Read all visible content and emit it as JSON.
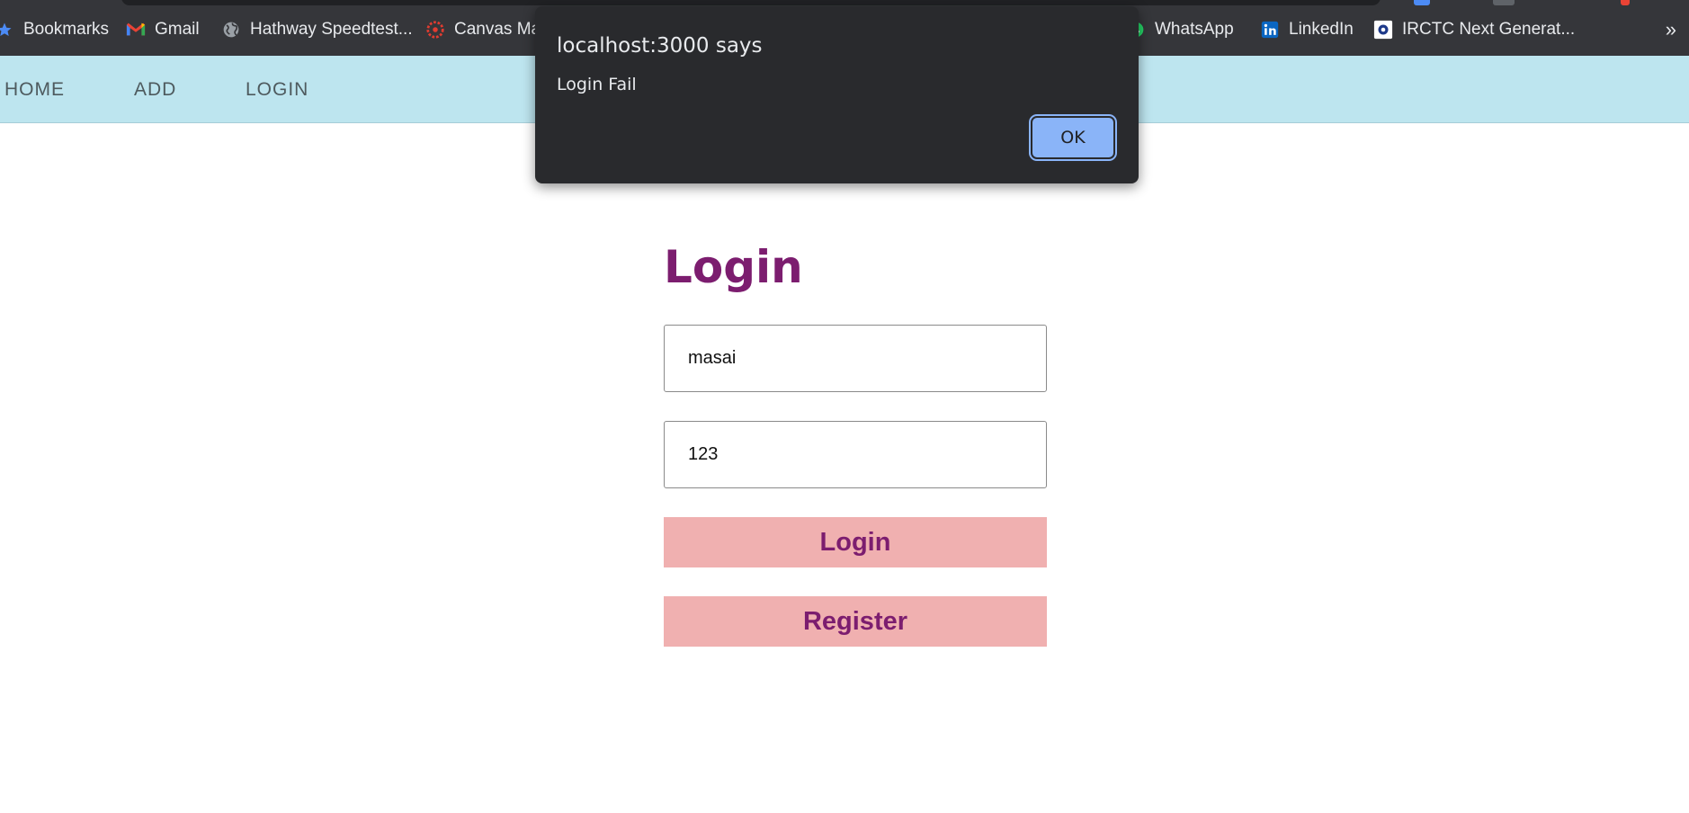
{
  "browser": {
    "bookmarks": [
      {
        "label": "Bookmarks",
        "icon": "star-icon"
      },
      {
        "label": "Gmail",
        "icon": "gmail-icon"
      },
      {
        "label": "Hathway Speedtest...",
        "icon": "globe-icon"
      },
      {
        "label": "Canvas Ma",
        "icon": "canvas-icon"
      },
      {
        "label": "WhatsApp",
        "icon": "whatsapp-icon"
      },
      {
        "label": "LinkedIn",
        "icon": "linkedin-icon"
      },
      {
        "label": "IRCTC Next Generat...",
        "icon": "irctc-icon"
      }
    ],
    "overflow_label": "»"
  },
  "nav": {
    "items": [
      {
        "label": "HOME"
      },
      {
        "label": "ADD"
      },
      {
        "label": "LOGIN"
      }
    ]
  },
  "login": {
    "title": "Login",
    "username_value": "masai",
    "password_value": "123",
    "login_button": "Login",
    "register_button": "Register"
  },
  "dialog": {
    "title": "localhost:3000 says",
    "message": "Login Fail",
    "ok_label": "OK"
  },
  "colors": {
    "nav_bg": "#bde5ef",
    "accent_purple": "#7c1d6f",
    "button_pink": "#f0b0b0",
    "dialog_bg": "#292a2d",
    "ok_blue": "#8ab4f8"
  }
}
